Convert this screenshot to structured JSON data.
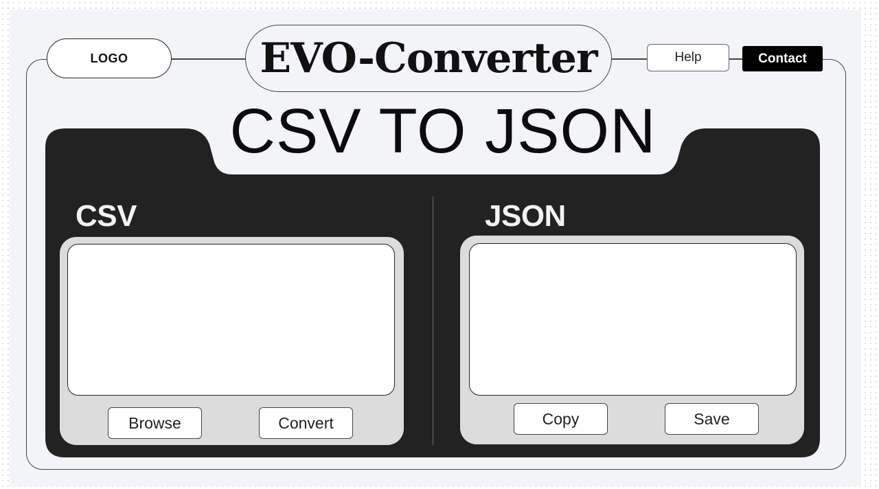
{
  "header": {
    "logo_label": "LOGO",
    "app_title": "EVO-Converter",
    "help_label": "Help",
    "contact_label": "Contact"
  },
  "main": {
    "title": "CSV TO JSON",
    "left": {
      "heading": "CSV",
      "input_value": "",
      "browse_label": "Browse",
      "convert_label": "Convert"
    },
    "right": {
      "heading": "JSON",
      "output_value": "",
      "copy_label": "Copy",
      "save_label": "Save"
    }
  },
  "colors": {
    "panel": "#222222",
    "page": "#f3f4f8",
    "box_frame": "#dcdcdc",
    "contact_bg": "#000000"
  }
}
